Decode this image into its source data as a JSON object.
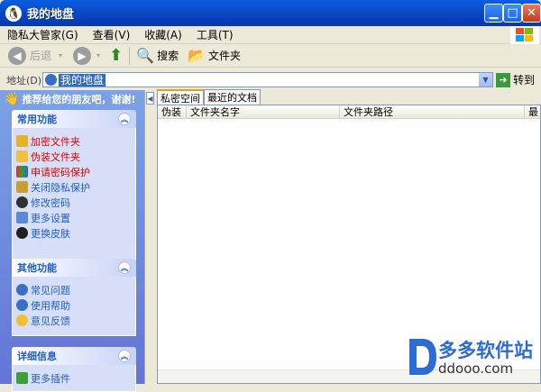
{
  "window": {
    "title": "我的地盘",
    "title_icon": "penguin-icon"
  },
  "menu": [
    "隐私大管家(G)",
    "查看(V)",
    "收藏(A)",
    "工具(T)"
  ],
  "toolbar": {
    "back": "后退",
    "search": "搜索",
    "folders": "文件夹"
  },
  "address": {
    "label": "地址(D)",
    "value": "我的地盘",
    "go": "转到"
  },
  "sidebar": {
    "promo": "推荐给您的朋友吧，谢谢!",
    "panels": [
      {
        "title": "常用功能",
        "items": [
          "加密文件夹",
          "伪装文件夹",
          "申请密码保护",
          "关闭隐私保护",
          "修改密码",
          "更多设置",
          "更换皮肤"
        ]
      },
      {
        "title": "其他功能",
        "items": [
          "常见问题",
          "使用帮助",
          "意见反馈"
        ]
      },
      {
        "title": "详细信息",
        "items": [
          "更多插件"
        ]
      }
    ]
  },
  "tabs": [
    "私密空间",
    "最近的文档"
  ],
  "columns": [
    "伪装",
    "文件夹名字",
    "文件夹路径",
    "最"
  ],
  "watermark": {
    "brand": "多多软件站",
    "url": "ddooo.com"
  },
  "colors": {
    "title_blue": "#0b49c8",
    "link_blue": "#215dc6",
    "alert_red": "#e00000",
    "sidebar_top": "#7ba2e7"
  }
}
